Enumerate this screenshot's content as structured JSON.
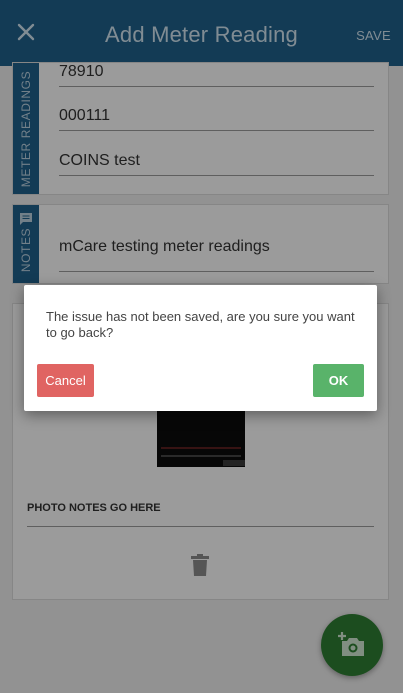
{
  "appbar": {
    "title": "Add Meter Reading",
    "save_label": "SAVE",
    "close_icon": "close-icon"
  },
  "meter_readings": {
    "section_label": "METER READINGS",
    "values": [
      "78910",
      "000111",
      "COINS test"
    ]
  },
  "notes": {
    "section_label": "NOTES",
    "text": "mCare testing meter readings"
  },
  "photo": {
    "notes_label": "PHOTO NOTES GO HERE"
  },
  "dialog": {
    "message": "The issue has not been saved, are you sure you want to go back?",
    "cancel_label": "Cancel",
    "ok_label": "OK"
  },
  "colors": {
    "primary": "#1f5f8a",
    "fab": "#2e7d32",
    "cancel": "#e06462",
    "ok": "#59b36a"
  }
}
